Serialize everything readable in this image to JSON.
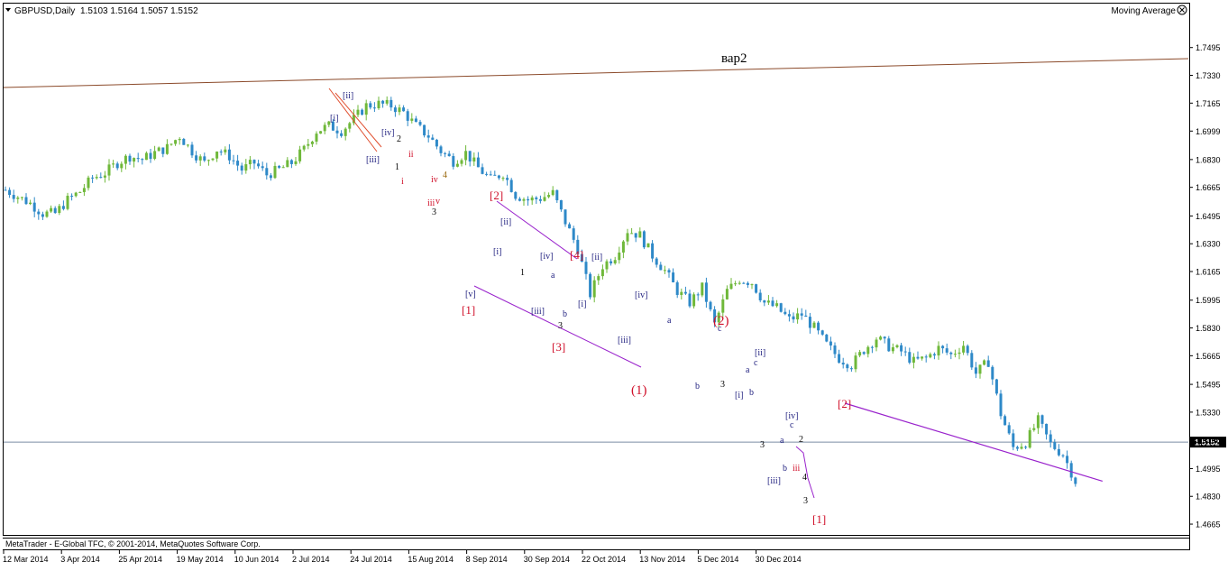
{
  "header": {
    "symbol": "GBPUSD,Daily",
    "ohlc": "1.5103 1.5164 1.5057 1.5152",
    "indicator": "Moving Average"
  },
  "footer": {
    "copyright": "MetaTrader - E-Global TFC, © 2001-2014, MetaQuotes Software Corp."
  },
  "colors": {
    "bull": "#6fb83a",
    "bear": "#2e89c8",
    "red_label": "#d0102a",
    "navy_label": "#1f1f7f",
    "purple_line": "#9922cc",
    "trend_line": "#8b4a2a",
    "price_line": "#7a8da4",
    "frame": "#000000"
  },
  "chart_data": {
    "type": "candlestick",
    "ylim": [
      1.4617,
      1.7622
    ],
    "y_ticks": [
      "1.7495",
      "1.7330",
      "1.7165",
      "1.6999",
      "1.6830",
      "1.6665",
      "1.6495",
      "1.6330",
      "1.6165",
      "1.5995",
      "1.5830",
      "1.5665",
      "1.5495",
      "1.5330",
      "1.5165",
      "1.4995",
      "1.4830",
      "1.4665"
    ],
    "x_ticks": [
      "12 Mar 2014",
      "3 Apr 2014",
      "25 Apr 2014",
      "19 May 2014",
      "10 Jun 2014",
      "2 Jul 2014",
      "24 Jul 2014",
      "15 Aug 2014",
      "8 Sep 2014",
      "30 Sep 2014",
      "22 Oct 2014",
      "13 Nov 2014",
      "5 Dec 2014",
      "30 Dec 2014"
    ],
    "current_price": "1.5152",
    "trend_label": "вар2",
    "waves": [
      {
        "t": "[ii]",
        "c": "navy"
      },
      {
        "t": "[i]",
        "c": "navy"
      },
      {
        "t": "[iii]",
        "c": "navy"
      },
      {
        "t": "[iv]",
        "c": "navy"
      },
      {
        "t": "2",
        "c": "black"
      },
      {
        "t": "1",
        "c": "black"
      },
      {
        "t": "ii",
        "c": "red"
      },
      {
        "t": "i",
        "c": "red"
      },
      {
        "t": "iv",
        "c": "red"
      },
      {
        "t": "iii",
        "c": "red"
      },
      {
        "t": "v",
        "c": "red"
      },
      {
        "t": "4",
        "c": "olive"
      },
      {
        "t": "3",
        "c": "black"
      },
      {
        "t": "[2]",
        "c": "red"
      },
      {
        "t": "[1]",
        "c": "red"
      },
      {
        "t": "[v]",
        "c": "navy"
      },
      {
        "t": "[i]",
        "c": "navy"
      },
      {
        "t": "[ii]",
        "c": "navy"
      },
      {
        "t": "[iii]",
        "c": "navy"
      },
      {
        "t": "[iv]",
        "c": "navy"
      },
      {
        "t": "[4]",
        "c": "red"
      },
      {
        "t": "[3]",
        "c": "red"
      },
      {
        "t": "3",
        "c": "black"
      },
      {
        "t": "1",
        "c": "black"
      },
      {
        "t": "b",
        "c": "navy"
      },
      {
        "t": "a",
        "c": "navy"
      },
      {
        "t": "[i]",
        "c": "navy"
      },
      {
        "t": "[ii]",
        "c": "navy"
      },
      {
        "t": "[iii]",
        "c": "navy"
      },
      {
        "t": "[iv]",
        "c": "navy"
      },
      {
        "t": "(1)",
        "c": "red"
      },
      {
        "t": "a",
        "c": "navy"
      },
      {
        "t": "b",
        "c": "navy"
      },
      {
        "t": "c",
        "c": "navy"
      },
      {
        "t": "(2)",
        "c": "red"
      },
      {
        "t": "3",
        "c": "black"
      },
      {
        "t": "[ii]",
        "c": "navy"
      },
      {
        "t": "[i]",
        "c": "navy"
      },
      {
        "t": "a",
        "c": "navy"
      },
      {
        "t": "b",
        "c": "navy"
      },
      {
        "t": "c",
        "c": "navy"
      },
      {
        "t": "3",
        "c": "black"
      },
      {
        "t": "[iv]",
        "c": "navy"
      },
      {
        "t": "[iii]",
        "c": "navy"
      },
      {
        "t": "a",
        "c": "navy"
      },
      {
        "t": "b",
        "c": "navy"
      },
      {
        "t": "c",
        "c": "navy"
      },
      {
        "t": "2",
        "c": "black"
      },
      {
        "t": "iii",
        "c": "red"
      },
      {
        "t": "4",
        "c": "black"
      },
      {
        "t": "3",
        "c": "black"
      },
      {
        "t": "[1]",
        "c": "red"
      },
      {
        "t": "[2]",
        "c": "red"
      }
    ],
    "path": [
      [
        0,
        1.665
      ],
      [
        3,
        1.661
      ],
      [
        6,
        1.657
      ],
      [
        9,
        1.651
      ],
      [
        12,
        1.651
      ],
      [
        15,
        1.659
      ],
      [
        18,
        1.664
      ],
      [
        21,
        1.672
      ],
      [
        24,
        1.675
      ],
      [
        27,
        1.681
      ],
      [
        30,
        1.685
      ],
      [
        33,
        1.683
      ],
      [
        36,
        1.687
      ],
      [
        39,
        1.69
      ],
      [
        42,
        1.697
      ],
      [
        45,
        1.688
      ],
      [
        48,
        1.681
      ],
      [
        51,
        1.689
      ],
      [
        54,
        1.685
      ],
      [
        57,
        1.677
      ],
      [
        60,
        1.681
      ],
      [
        63,
        1.674
      ],
      [
        66,
        1.677
      ],
      [
        69,
        1.681
      ],
      [
        72,
        1.689
      ],
      [
        75,
        1.7
      ],
      [
        78,
        1.703
      ],
      [
        81,
        1.7
      ],
      [
        84,
        1.707
      ],
      [
        87,
        1.715
      ],
      [
        90,
        1.716
      ],
      [
        93,
        1.715
      ],
      [
        96,
        1.711
      ],
      [
        99,
        1.703
      ],
      [
        102,
        1.697
      ],
      [
        105,
        1.688
      ],
      [
        108,
        1.682
      ],
      [
        111,
        1.687
      ],
      [
        114,
        1.678
      ],
      [
        117,
        1.671
      ],
      [
        120,
        1.675
      ],
      [
        123,
        1.662
      ],
      [
        126,
        1.659
      ],
      [
        129,
        1.66
      ],
      [
        132,
        1.663
      ],
      [
        135,
        1.646
      ],
      [
        138,
        1.63
      ],
      [
        141,
        1.603
      ],
      [
        144,
        1.62
      ],
      [
        147,
        1.626
      ],
      [
        150,
        1.641
      ],
      [
        153,
        1.638
      ],
      [
        156,
        1.626
      ],
      [
        159,
        1.617
      ],
      [
        162,
        1.605
      ],
      [
        165,
        1.598
      ],
      [
        168,
        1.607
      ],
      [
        171,
        1.585
      ],
      [
        174,
        1.605
      ],
      [
        177,
        1.612
      ],
      [
        180,
        1.61
      ],
      [
        183,
        1.598
      ],
      [
        186,
        1.595
      ],
      [
        189,
        1.588
      ],
      [
        192,
        1.591
      ],
      [
        195,
        1.583
      ],
      [
        198,
        1.573
      ],
      [
        201,
        1.565
      ],
      [
        204,
        1.561
      ],
      [
        207,
        1.57
      ],
      [
        210,
        1.577
      ],
      [
        213,
        1.572
      ],
      [
        216,
        1.569
      ],
      [
        219,
        1.563
      ],
      [
        222,
        1.565
      ],
      [
        225,
        1.571
      ],
      [
        228,
        1.567
      ],
      [
        231,
        1.573
      ],
      [
        234,
        1.556
      ],
      [
        237,
        1.563
      ],
      [
        240,
        1.532
      ],
      [
        243,
        1.512
      ],
      [
        246,
        1.515
      ],
      [
        249,
        1.528
      ],
      [
        252,
        1.514
      ],
      [
        255,
        1.508
      ],
      [
        258,
        1.492
      ]
    ],
    "purple_path": [
      [
        258,
        1.492
      ],
      [
        264,
        1.542
      ]
    ]
  }
}
